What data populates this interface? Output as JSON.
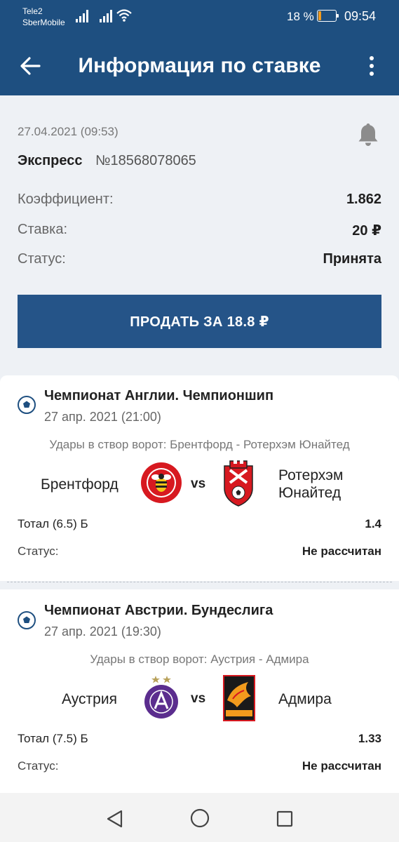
{
  "status_bar": {
    "carrier_line1": "Tele2",
    "carrier_line2": "SberMobile",
    "battery_percent": "18 %",
    "battery_level": 0.18,
    "time": "09:54"
  },
  "app_bar": {
    "title": "Информация по ставке",
    "back_icon": "arrow-left-icon",
    "menu_icon": "more-vert-icon"
  },
  "bet": {
    "datetime": "27.04.2021 (09:53)",
    "type": "Экспресс",
    "number": "№18568078065",
    "coefficient_label": "Коэффициент:",
    "coefficient_value": "1.862",
    "stake_label": "Ставка:",
    "stake_value": "20 ₽",
    "status_label": "Статус:",
    "status_value": "Принята",
    "sell_button": "ПРОДАТЬ ЗА 18.8 ₽"
  },
  "events": [
    {
      "league": "Чемпионат Англии. Чемпионшип",
      "date": "27 апр. 2021 (21:00)",
      "market": "Удары в створ ворот: Брентфорд - Ротерхэм Юнайтед",
      "home_team": "Брентфорд",
      "vs": "vs",
      "away_team_line1": "Ротерхэм",
      "away_team_line2": "Юнайтед",
      "selection": "Тотал (6.5) Б",
      "odd": "1.4",
      "status_label": "Статус:",
      "status_value": "Не рассчитан"
    },
    {
      "league": "Чемпионат Австрии. Бундеслига",
      "date": "27 апр. 2021 (19:30)",
      "market": "Удары в створ ворот: Аустрия - Адмира",
      "home_team": "Аустрия",
      "vs": "vs",
      "away_team": "Адмира",
      "selection": "Тотал (7.5) Б",
      "odd": "1.33",
      "status_label": "Статус:",
      "status_value": "Не рассчитан"
    }
  ],
  "colors": {
    "header_bg": "#1e4f80",
    "button_bg": "#255488",
    "page_bg": "#eef1f5",
    "battery_accent": "#f29b1d"
  }
}
